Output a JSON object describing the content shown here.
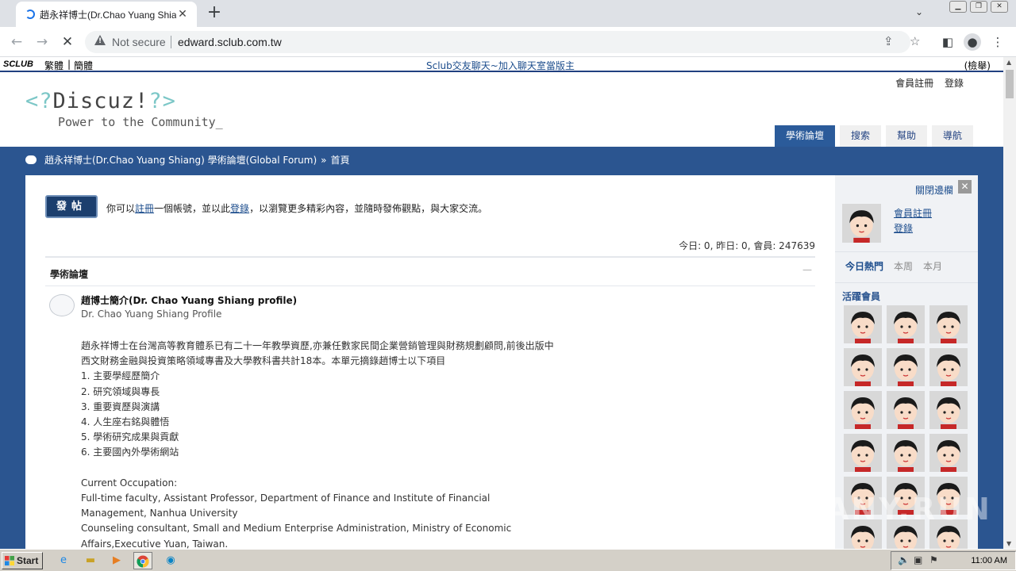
{
  "browser": {
    "tab_title": "趙永祥博士(Dr.Chao Yuang Shiang)",
    "tab_close": "✕",
    "new_tab": "+",
    "not_secure": "Not secure",
    "url": "edward.sclub.com.tw",
    "icons": [
      "back-arrow-icon",
      "forward-arrow-icon",
      "stop-loading-icon",
      "warning-triangle-icon",
      "share-icon",
      "star-icon",
      "sidebar-icon",
      "profile-icon",
      "kebab-menu-icon"
    ]
  },
  "sclub": {
    "logo": "SCLUB",
    "lang_trad": "繁體",
    "lang_simp": "簡體",
    "center": "Sclub交友聊天~加入聊天室當版主",
    "right": "(檢舉)"
  },
  "header": {
    "register": "會員註冊",
    "login": "登錄",
    "logo_left": "<?",
    "logo_word": "Discuz!",
    "logo_right": "?>",
    "tagline": "Power to the Community_",
    "nav": [
      "學術論壇",
      "搜索",
      "幫助",
      "導航"
    ]
  },
  "breadcrumb": {
    "forum": "趙永祥博士(Dr.Chao Yuang Shiang) 學術論壇(Global Forum)",
    "sep": "»",
    "home": "首頁"
  },
  "main": {
    "post_button": "發帖",
    "notice_pre": "你可以",
    "notice_register": "註冊",
    "notice_mid": "一個帳號，並以此",
    "notice_login": "登錄",
    "notice_post": "，以瀏覽更多精彩內容，並隨時發佈觀點，與大家交流。",
    "stats": "今日: 0, 昨日: 0, 會員: 247639",
    "section_title": "學術論壇",
    "collapse": "—",
    "forum": {
      "title": "趙博士簡介(Dr. Chao Yuang Shiang profile)",
      "subtitle": "Dr. Chao Yuang Shiang Profile",
      "body": [
        "趙永祥博士在台灣高等教育體系已有二十一年教學資歷,亦兼任數家民間企業營銷管理與財務規劃顧問,前後出版中",
        "西文財務金融與投資策略領域專書及大學教科書共計18本。本單元摘錄趙博士以下項目",
        "1. 主要學經歷簡介",
        "2. 研究領域與專長",
        "3. 重要資歷與演講",
        "4. 人生座右銘與體悟",
        "5. 學術研究成果與貢獻",
        "6. 主要國內外學術網站",
        "",
        "Current Occupation:",
        "Full-time faculty, Assistant Professor, Department of Finance and Institute of Financial",
        "Management, Nanhua University",
        "Counseling consultant, Small and Medium Enterprise Administration, Ministry of Economic",
        "Affairs,Executive Yuan, Taiwan."
      ]
    }
  },
  "sidebar": {
    "close_label": "關閉邊欄",
    "close_x": "✕",
    "register": "會員註冊",
    "login": "登錄",
    "tabs": [
      "今日熱門",
      "本周",
      "本月"
    ],
    "active_members": "活躍會員",
    "member_count": 18
  },
  "watermark": "ANY.RUN",
  "taskbar": {
    "start": "Start",
    "clock": "11:00 AM",
    "apps": [
      "ie-icon",
      "folder-icon",
      "media-player-icon",
      "chrome-icon",
      "edge-icon"
    ]
  },
  "colors": {
    "site_blue": "#2b5590",
    "link_blue": "#1b4c8c",
    "nav_active": "#2b5b9a",
    "logo_teal": "#7cc7c7"
  }
}
